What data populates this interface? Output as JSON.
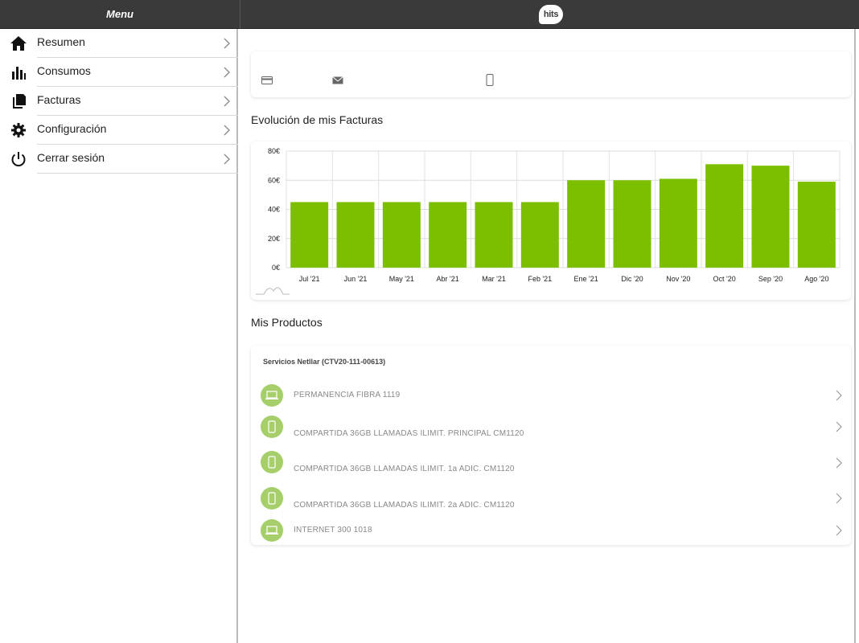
{
  "header": {
    "menu_title": "Menu",
    "logo_text": "hits"
  },
  "sidebar": {
    "items": [
      {
        "label": "Resumen",
        "icon": "home-icon"
      },
      {
        "label": "Consumos",
        "icon": "bar-chart-icon"
      },
      {
        "label": "Facturas",
        "icon": "documents-icon"
      },
      {
        "label": "Configuración",
        "icon": "gear-icon"
      },
      {
        "label": "Cerrar sesión",
        "icon": "power-icon"
      }
    ]
  },
  "summary_card": {
    "icons": [
      "credit-card-icon",
      "envelope-icon",
      "mobile-phone-icon"
    ]
  },
  "invoices": {
    "title": "Evolución de mis Facturas"
  },
  "chart_data": {
    "type": "bar",
    "categories": [
      "Jul '21",
      "Jun '21",
      "May '21",
      "Abr '21",
      "Mar '21",
      "Feb '21",
      "Ene '21",
      "Dic '20",
      "Nov '20",
      "Oct '20",
      "Sep '20",
      "Ago '20"
    ],
    "values": [
      45,
      45,
      45,
      45,
      45,
      45,
      60,
      60,
      61,
      71,
      70,
      59
    ],
    "yticks": [
      "0€",
      "20€",
      "40€",
      "60€",
      "80€"
    ],
    "ylim": [
      0,
      80
    ],
    "bar_color": "#7cbf00",
    "grid": true
  },
  "products": {
    "title": "Mis Productos",
    "service_title": "Servicios Netllar (CTV20-111-00613)",
    "items": [
      {
        "label": "PERMANENCIA FIBRA 1119",
        "icon": "laptop-icon"
      },
      {
        "label": "COMPARTIDA 36GB LLAMADAS ILIMIT. PRINCIPAL CM1120",
        "icon": "mobile-phone-icon"
      },
      {
        "label": "COMPARTIDA 36GB LLAMADAS ILIMIT. 1a ADIC. CM1120",
        "icon": "mobile-phone-icon"
      },
      {
        "label": "COMPARTIDA 36GB LLAMADAS ILIMIT. 2a ADIC. CM1120",
        "icon": "mobile-phone-icon"
      },
      {
        "label": "INTERNET 300 1018",
        "icon": "laptop-icon"
      }
    ],
    "icon_color": "#a6cf6b"
  }
}
